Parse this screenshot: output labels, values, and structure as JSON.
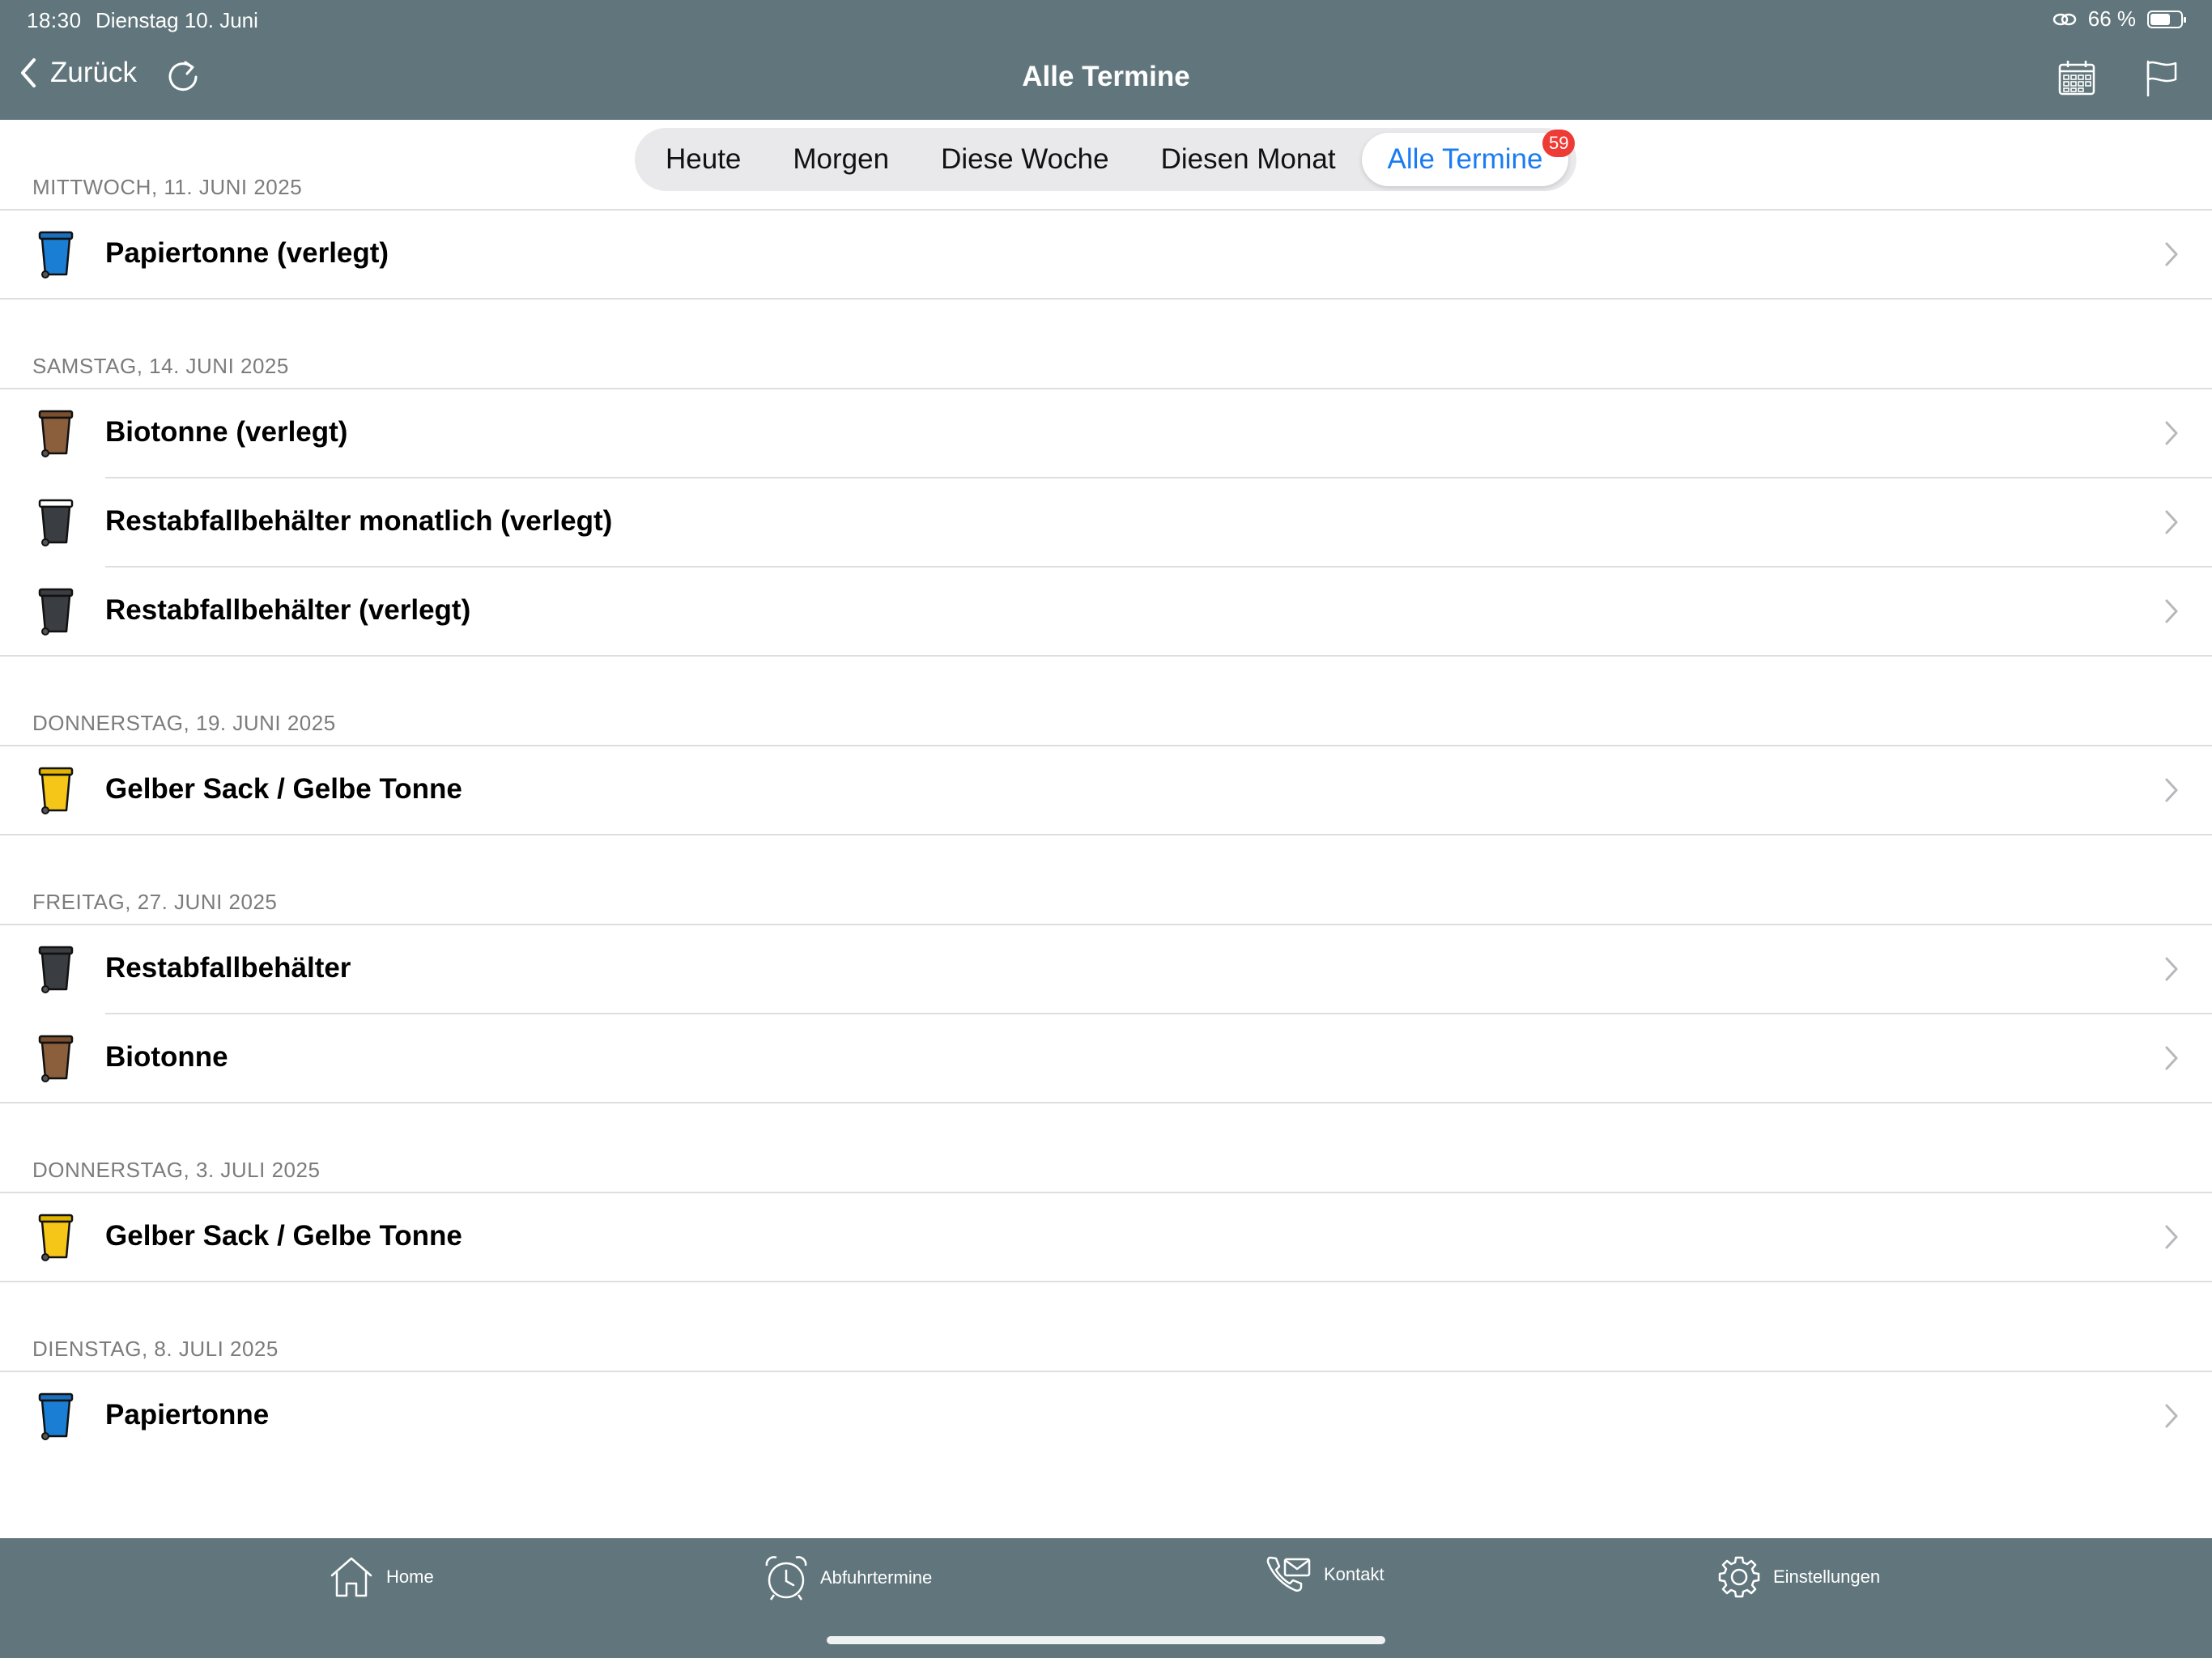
{
  "status_bar": {
    "time": "18:30",
    "date": "Dienstag 10. Juni",
    "battery": "66 %"
  },
  "nav": {
    "back_label": "Zurück",
    "title": "Alle Termine"
  },
  "segments": {
    "items": [
      "Heute",
      "Morgen",
      "Diese Woche",
      "Diesen Monat",
      "Alle Termine"
    ],
    "selected": "Alle Termine",
    "badge": "59"
  },
  "sections": [
    {
      "date": "MITTWOCH, 11. JUNI 2025",
      "items": [
        {
          "label": "Papiertonne (verlegt)",
          "bin": "blue-bin-icon"
        }
      ]
    },
    {
      "date": "SAMSTAG, 14. JUNI 2025",
      "items": [
        {
          "label": "Biotonne (verlegt)",
          "bin": "brown-bin-icon"
        },
        {
          "label": "Restabfallbehälter monatlich (verlegt)",
          "bin": "black-bin-icon"
        },
        {
          "label": "Restabfallbehälter (verlegt)",
          "bin": "black-bin-icon"
        }
      ]
    },
    {
      "date": "DONNERSTAG, 19. JUNI 2025",
      "items": [
        {
          "label": "Gelber Sack / Gelbe Tonne",
          "bin": "yellow-bin-icon"
        }
      ]
    },
    {
      "date": "FREITAG, 27. JUNI 2025",
      "items": [
        {
          "label": "Restabfallbehälter",
          "bin": "black-bin-icon"
        },
        {
          "label": "Biotonne",
          "bin": "brown-bin-icon"
        }
      ]
    },
    {
      "date": "DONNERSTAG, 3. JULI 2025",
      "items": [
        {
          "label": "Gelber Sack / Gelbe Tonne",
          "bin": "yellow-bin-icon"
        }
      ]
    },
    {
      "date": "DIENSTAG, 8. JULI 2025",
      "items": [
        {
          "label": "Papiertonne",
          "bin": "blue-bin-icon"
        }
      ]
    }
  ],
  "tabbar": {
    "home": "Home",
    "abfuhr": "Abfuhrtermine",
    "kontakt": "Kontakt",
    "einstellungen": "Einstellungen"
  },
  "colors": {
    "bar": "#61767c",
    "accent": "#1a7cf4",
    "badge": "#ef3b35",
    "bin_blue": "#1a6fbf",
    "bin_brown": "#8b5e3c",
    "bin_black": "#3a3d42",
    "bin_yellow": "#f5c518"
  }
}
